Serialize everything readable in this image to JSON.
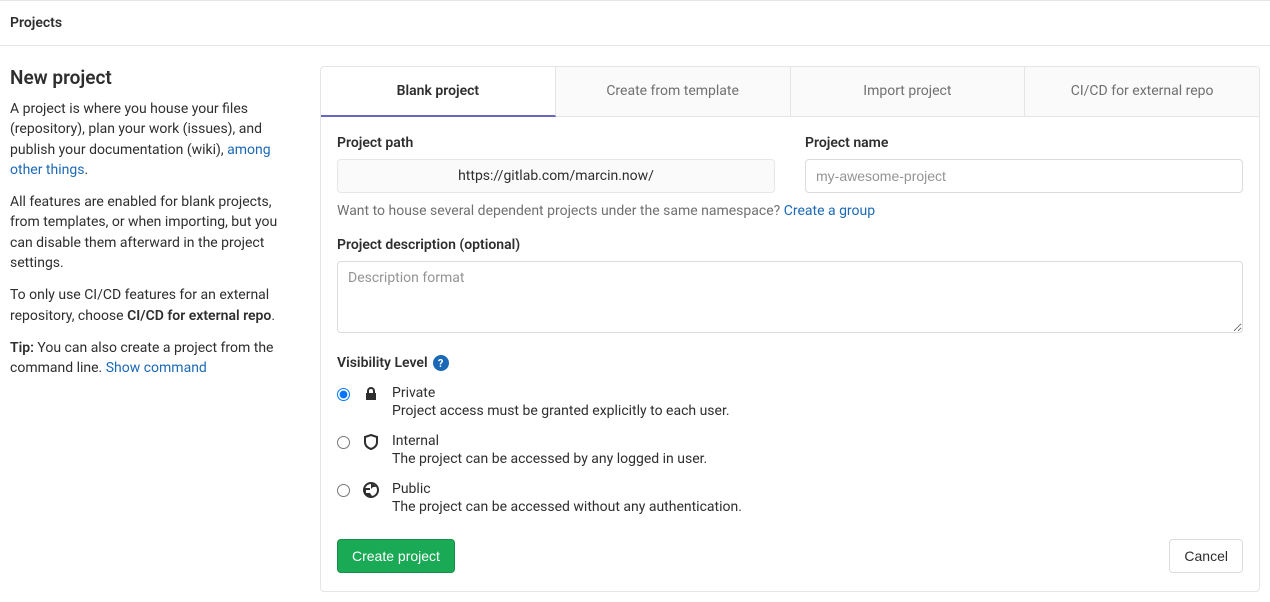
{
  "header": {
    "breadcrumb": "Projects"
  },
  "sidebar": {
    "title": "New project",
    "p1_a": "A project is where you house your files (repository), plan your work (issues), and publish your documentation (wiki), ",
    "p1_link": "among other things",
    "p1_b": ".",
    "p2": "All features are enabled for blank projects, from templates, or when importing, but you can disable them afterward in the project settings.",
    "p3_a": "To only use CI/CD features for an external repository, choose ",
    "p3_b": "CI/CD for external repo",
    "p3_c": ".",
    "tip_label": "Tip:",
    "tip_text": " You can also create a project from the command line. ",
    "tip_link": "Show command"
  },
  "tabs": {
    "blank": "Blank project",
    "template": "Create from template",
    "import": "Import project",
    "cicd": "CI/CD for external repo"
  },
  "form": {
    "path_label": "Project path",
    "path_value": "https://gitlab.com/marcin.now/",
    "name_label": "Project name",
    "name_placeholder": "my-awesome-project",
    "namespace_hint": "Want to house several dependent projects under the same namespace? ",
    "namespace_link": "Create a group",
    "desc_label": "Project description (optional)",
    "desc_placeholder": "Description format",
    "visibility_label": "Visibility Level",
    "visibility": {
      "private": {
        "title": "Private",
        "desc": "Project access must be granted explicitly to each user."
      },
      "internal": {
        "title": "Internal",
        "desc": "The project can be accessed by any logged in user."
      },
      "public": {
        "title": "Public",
        "desc": "The project can be accessed without any authentication."
      }
    },
    "create_button": "Create project",
    "cancel_button": "Cancel"
  }
}
